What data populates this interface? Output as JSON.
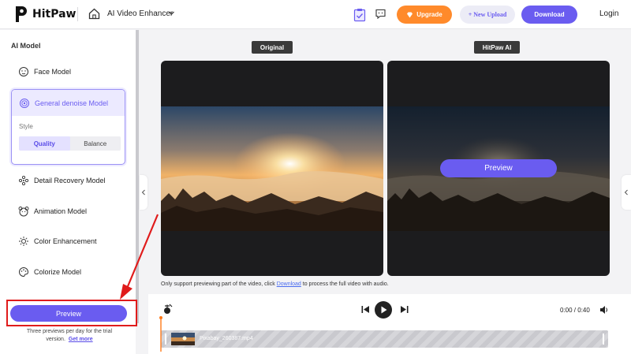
{
  "header": {
    "logo_text": "HitPaw",
    "app_title": "AI Video Enhancer",
    "upgrade_label": "Upgrade",
    "new_upload_label": "+ New Upload",
    "download_label": "Download",
    "login_label": "Login"
  },
  "sidebar": {
    "title": "AI Model",
    "models": [
      {
        "label": "Face Model",
        "icon": "face-icon"
      },
      {
        "label": "General denoise Model",
        "icon": "denoise-icon",
        "selected": true
      },
      {
        "label": "Detail Recovery Model",
        "icon": "detail-icon"
      },
      {
        "label": "Animation Model",
        "icon": "animation-icon"
      },
      {
        "label": "Color Enhancement",
        "icon": "color-icon"
      },
      {
        "label": "Colorize Model",
        "icon": "palette-icon"
      }
    ],
    "style_label": "Style",
    "style_options": [
      "Quality",
      "Balance"
    ],
    "style_selected": "Quality",
    "preview_label": "Preview",
    "trial_note": "Three previews per day for the trial version.",
    "get_more_label": "Get more"
  },
  "main": {
    "original_label": "Original",
    "ai_label": "HitPaw AI",
    "panel_preview_label": "Preview",
    "notice_before": "Only support previewing part of the video, click ",
    "notice_link": "Download",
    "notice_after": " to process the full video with audio."
  },
  "player": {
    "time": "0:00 / 0:40",
    "clip_name": "Pixabay_260387.mp4"
  },
  "colors": {
    "accent": "#6a5cf0",
    "upgrade": "#ff8a2b",
    "highlight_box": "#e01b1b"
  }
}
